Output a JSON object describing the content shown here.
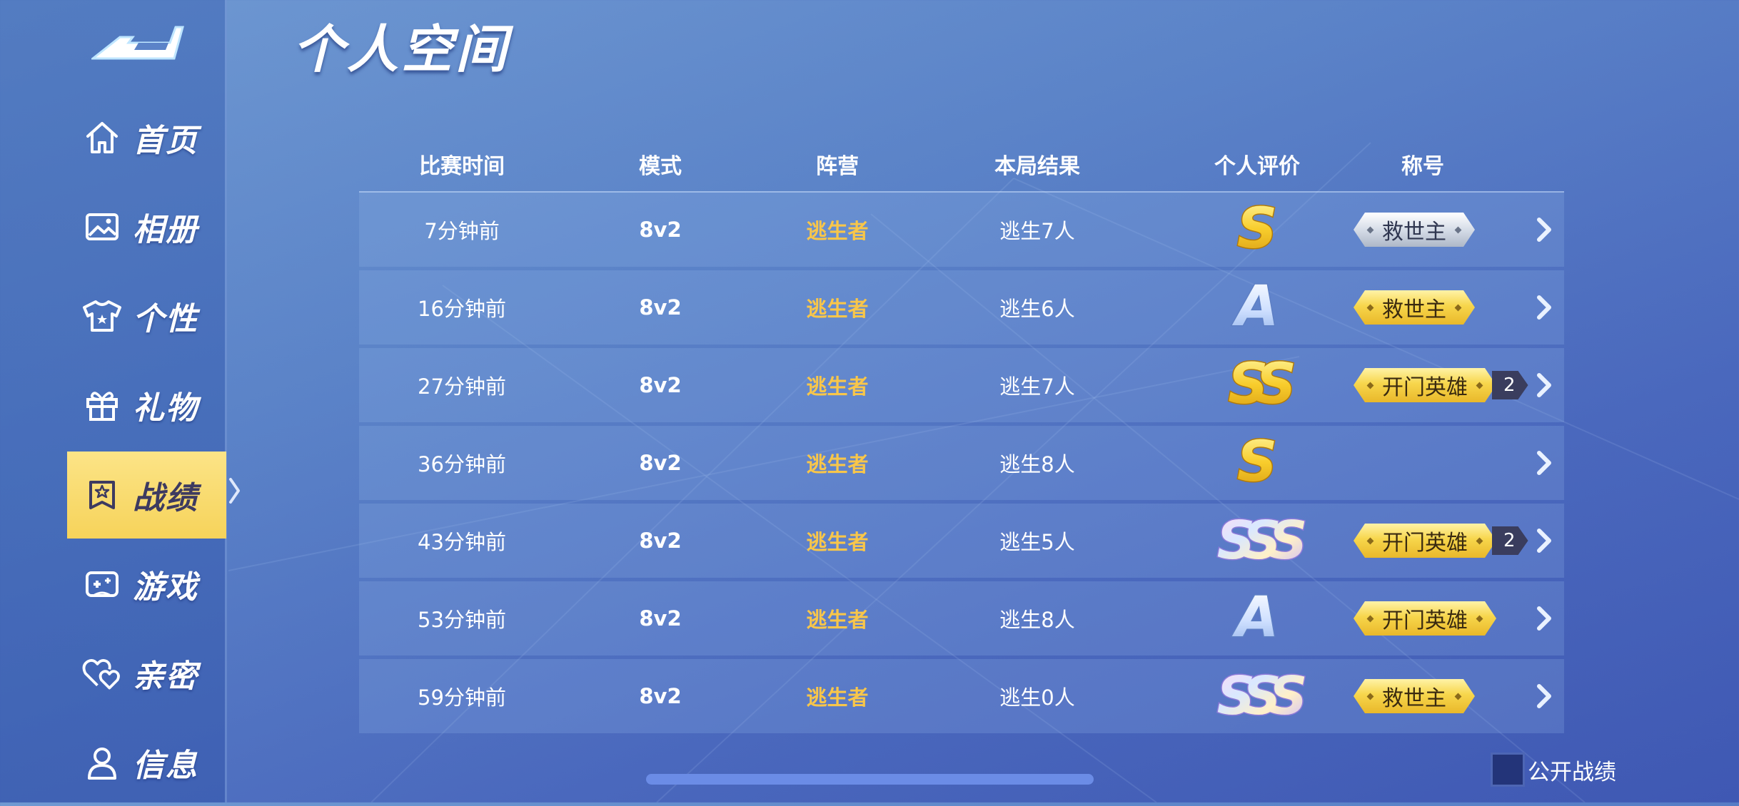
{
  "title": "个人空间",
  "sidebar": {
    "items": [
      {
        "label": "首页",
        "icon": "home-icon"
      },
      {
        "label": "相册",
        "icon": "image-icon"
      },
      {
        "label": "个性",
        "icon": "shirt-icon"
      },
      {
        "label": "礼物",
        "icon": "gift-icon"
      },
      {
        "label": "战绩",
        "icon": "badge-star-icon",
        "active": true
      },
      {
        "label": "游戏",
        "icon": "gamepad-icon"
      },
      {
        "label": "亲密",
        "icon": "hearts-icon"
      },
      {
        "label": "信息",
        "icon": "user-icon"
      }
    ]
  },
  "table": {
    "headers": {
      "time": "比赛时间",
      "mode": "模式",
      "camp": "阵营",
      "result": "本局结果",
      "rating": "个人评价",
      "title": "称号"
    },
    "rows": [
      {
        "time": "7分钟前",
        "mode": "8v2",
        "camp": "逃生者",
        "result": "逃生7人",
        "rating": "S",
        "badge": "救世主",
        "badge_style": "silver",
        "badge_count": null
      },
      {
        "time": "16分钟前",
        "mode": "8v2",
        "camp": "逃生者",
        "result": "逃生6人",
        "rating": "A",
        "badge": "救世主",
        "badge_style": "gold",
        "badge_count": null
      },
      {
        "time": "27分钟前",
        "mode": "8v2",
        "camp": "逃生者",
        "result": "逃生7人",
        "rating": "SS",
        "badge": "开门英雄",
        "badge_style": "gold",
        "badge_count": "2"
      },
      {
        "time": "36分钟前",
        "mode": "8v2",
        "camp": "逃生者",
        "result": "逃生8人",
        "rating": "S",
        "badge": null,
        "badge_style": null,
        "badge_count": null
      },
      {
        "time": "43分钟前",
        "mode": "8v2",
        "camp": "逃生者",
        "result": "逃生5人",
        "rating": "SSS",
        "badge": "开门英雄",
        "badge_style": "gold",
        "badge_count": "2"
      },
      {
        "time": "53分钟前",
        "mode": "8v2",
        "camp": "逃生者",
        "result": "逃生8人",
        "rating": "A",
        "badge": "开门英雄",
        "badge_style": "gold",
        "badge_count": null
      },
      {
        "time": "59分钟前",
        "mode": "8v2",
        "camp": "逃生者",
        "result": "逃生0人",
        "rating": "SSS",
        "badge": "救世主",
        "badge_style": "gold",
        "badge_count": null
      }
    ]
  },
  "footer": {
    "public_label": "公开战绩",
    "public_checked": false
  },
  "colors": {
    "accent_gold": "#f8c64a",
    "active_tab": "#f6d35a",
    "background": "#5b83c8"
  }
}
